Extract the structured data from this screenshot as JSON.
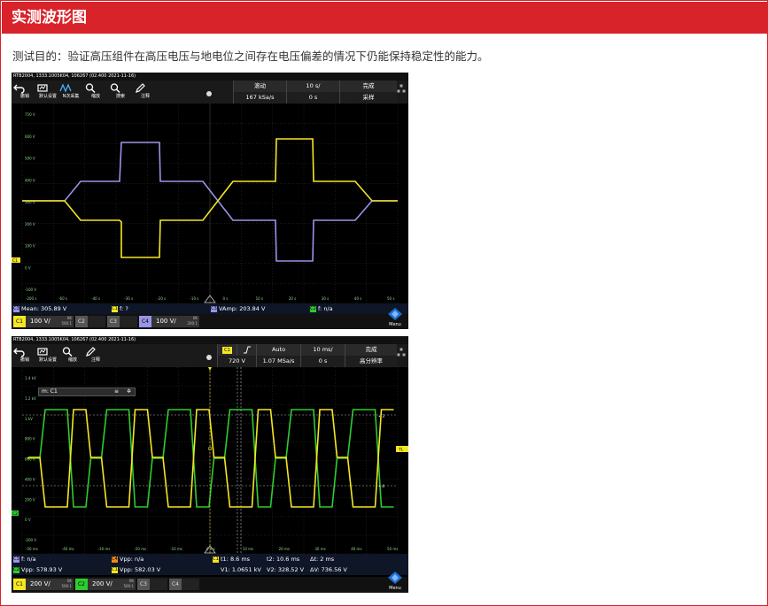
{
  "page": {
    "title": "实测波形图",
    "purpose": "测试目的：验证高压组件在高压电压与地电位之间存在电压偏差的情况下仍能保持稳定性的能力。"
  },
  "colors": {
    "accent": "#d9232a",
    "ch1": "#f5e623",
    "ch2": "#2ecc2e",
    "ch3": "#9a94e6",
    "ch4": "#f08a1c"
  },
  "scope1": {
    "header": "RTB2004, 1333.1005K04, 106267 (02.400 2021-11-16)",
    "toolbar": [
      {
        "icon": "undo-icon",
        "label": "撤销"
      },
      {
        "icon": "default-settings-icon",
        "label": "默认设置"
      },
      {
        "icon": "autoset-icon",
        "label": "N次采集"
      },
      {
        "icon": "zoom-icon",
        "label": "缩放"
      },
      {
        "icon": "search-icon",
        "label": "搜索"
      },
      {
        "icon": "pen-icon",
        "label": "注释"
      }
    ],
    "info": {
      "mode": "滚动",
      "timebase": "10 s/",
      "status": "完成",
      "rate": "167 kSa/s",
      "delay": "0 s",
      "acq": "采样"
    },
    "y_labels": [
      "750 V",
      "600 V",
      "500 V",
      "400 V",
      "300 V",
      "200 V",
      "100 V",
      "0 V",
      "-100 V"
    ],
    "x_labels": [
      "-200 s",
      "-60 s",
      "-40 s",
      "-30 s",
      "-20 s",
      "-10 s",
      "0 s",
      "10 s",
      "20 s",
      "30 s",
      "40 s",
      "50 s"
    ],
    "left_marker": "C1",
    "meas": [
      {
        "tag": "C3",
        "text": "Mean: 305.89 V"
      },
      {
        "tag": "C1",
        "text": "f: ?"
      },
      {
        "tag": "C3",
        "text": "VAmp: 203.84 V"
      },
      {
        "tag": "C2",
        "text": "f: n/a"
      }
    ],
    "channels": [
      {
        "label": "C1",
        "value": "100 V/",
        "bw": "0K",
        "bw2": "500:1",
        "on": true
      },
      {
        "label": "C2",
        "value": "",
        "bw": "",
        "bw2": "",
        "on": false
      },
      {
        "label": "C3",
        "value": "",
        "bw": "",
        "bw2": "",
        "on": false
      },
      {
        "label": "C4",
        "value": "100 V/",
        "bw": "0K",
        "bw2": "200:1",
        "on": true
      }
    ],
    "menu": "Menu"
  },
  "scope2": {
    "header": "RTB2004, 1333.1005K04, 106267 (02.400 2021-11-16)",
    "toolbar": [
      {
        "icon": "undo-icon",
        "label": "撤销"
      },
      {
        "icon": "default-settings-icon",
        "label": "默认设置"
      },
      {
        "icon": "zoom-icon",
        "label": "缩放"
      },
      {
        "icon": "pen-icon",
        "label": "注释"
      }
    ],
    "info": {
      "trig_src": "C1",
      "trig_level": "720 V",
      "trig_mode": "Auto",
      "timebase": "10 ms/",
      "status": "完成",
      "rate": "1.07 MSa/s",
      "delay": "0 s",
      "acq": "高分辨率"
    },
    "cursor_label": "m: C1",
    "y_labels": [
      "1.4 kV",
      "1.2 kV",
      "1 kV",
      "800 V",
      "600 V",
      "400 V",
      "200 V",
      "0 V",
      "-200 V"
    ],
    "x_labels": [
      "-50 ms",
      "-40 ms",
      "-30 ms",
      "-20 ms",
      "-10 ms",
      "0 ms",
      "10 ms",
      "20 ms",
      "30 ms",
      "40 ms",
      "50 ms"
    ],
    "left_marker": "C2",
    "right_marker": "TL",
    "cursor_tags": [
      "3",
      "4"
    ],
    "meas_row1": [
      {
        "tag": "C3",
        "text": "f: n/a"
      },
      {
        "tag": "C4",
        "text": "Vpp: n/a"
      },
      {
        "tag": "C1",
        "text": "t1: 8.6 ms"
      },
      {
        "tag": "",
        "text": "t2: 10.6 ms"
      },
      {
        "tag": "",
        "text": "Δt: 2 ms"
      }
    ],
    "meas_row2": [
      {
        "tag": "C2",
        "text": "Vpp: 578.93 V"
      },
      {
        "tag": "C1",
        "text": "Vpp: 582.03 V"
      },
      {
        "tag": "",
        "text": "V1: 1.0651 kV"
      },
      {
        "tag": "",
        "text": "V2: 328.52 V"
      },
      {
        "tag": "",
        "text": "ΔV: 736.56 V"
      }
    ],
    "channels": [
      {
        "label": "C1",
        "value": "200 V/",
        "bw": "0K",
        "bw2": "500:1",
        "on": true
      },
      {
        "label": "C2",
        "value": "200 V/",
        "bw": "0K",
        "bw2": "500:1",
        "on": true
      },
      {
        "label": "C3",
        "value": "",
        "bw": "",
        "bw2": "",
        "on": false
      },
      {
        "label": "C4",
        "value": "",
        "bw": "",
        "bw2": "",
        "on": false
      }
    ],
    "menu": "Menu"
  }
}
